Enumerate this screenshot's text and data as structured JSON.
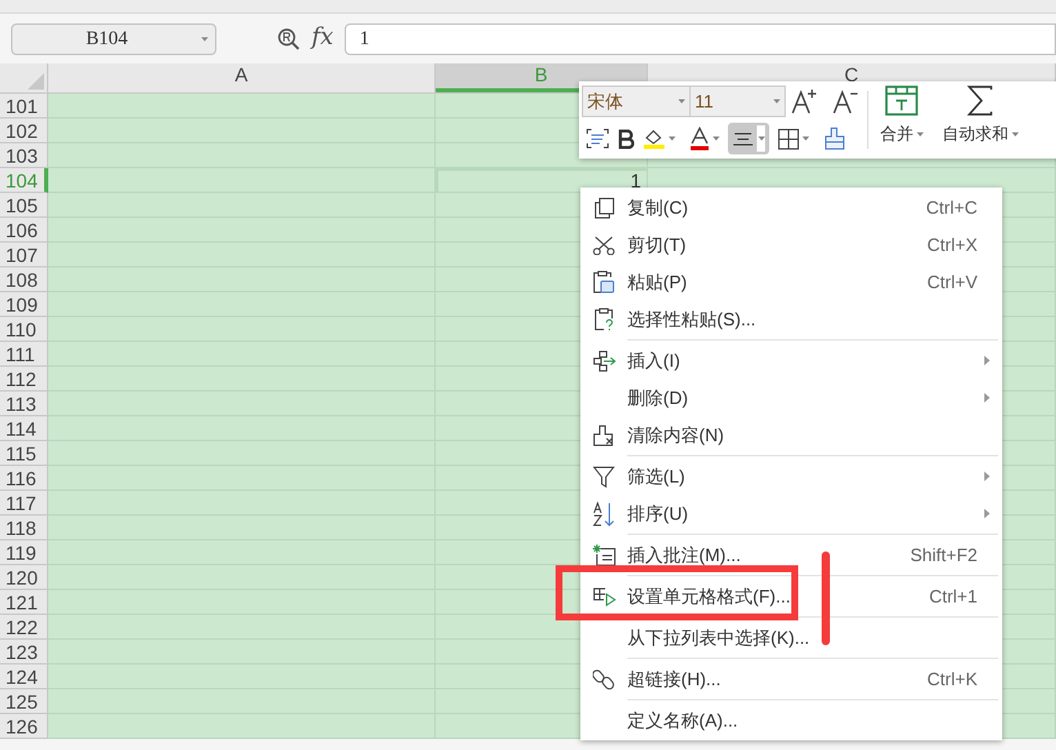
{
  "formula_bar": {
    "name_box": "B104",
    "function_label": "fx",
    "formula": "1"
  },
  "columns": [
    {
      "label": "A",
      "selected": false
    },
    {
      "label": "B",
      "selected": true
    },
    {
      "label": "C",
      "selected": false
    }
  ],
  "rows": [
    {
      "label": "101",
      "selected": false
    },
    {
      "label": "102",
      "selected": false
    },
    {
      "label": "103",
      "selected": false
    },
    {
      "label": "104",
      "selected": true,
      "cell_b": "1"
    },
    {
      "label": "105",
      "selected": false
    },
    {
      "label": "106",
      "selected": false
    },
    {
      "label": "107",
      "selected": false
    },
    {
      "label": "108",
      "selected": false
    },
    {
      "label": "109",
      "selected": false
    },
    {
      "label": "110",
      "selected": false
    },
    {
      "label": "111",
      "selected": false
    },
    {
      "label": "112",
      "selected": false
    },
    {
      "label": "113",
      "selected": false
    },
    {
      "label": "114",
      "selected": false
    },
    {
      "label": "115",
      "selected": false
    },
    {
      "label": "116",
      "selected": false
    },
    {
      "label": "117",
      "selected": false
    },
    {
      "label": "118",
      "selected": false
    },
    {
      "label": "119",
      "selected": false
    },
    {
      "label": "120",
      "selected": false
    },
    {
      "label": "121",
      "selected": false
    },
    {
      "label": "122",
      "selected": false
    },
    {
      "label": "123",
      "selected": false
    },
    {
      "label": "124",
      "selected": false
    },
    {
      "label": "125",
      "selected": false
    },
    {
      "label": "126",
      "selected": false
    }
  ],
  "mini_toolbar": {
    "font": "宋体",
    "size": "11",
    "merge": "合并",
    "autosum": "自动求和"
  },
  "context_menu": [
    {
      "kind": "item",
      "label": "复制(C)",
      "shortcut": "Ctrl+C",
      "submenu": false
    },
    {
      "kind": "item",
      "label": "剪切(T)",
      "shortcut": "Ctrl+X",
      "submenu": false
    },
    {
      "kind": "item",
      "label": "粘贴(P)",
      "shortcut": "Ctrl+V",
      "submenu": false
    },
    {
      "kind": "item",
      "label": "选择性粘贴(S)...",
      "submenu": false
    },
    {
      "kind": "separator"
    },
    {
      "kind": "item",
      "label": "插入(I)",
      "submenu": true
    },
    {
      "kind": "item",
      "label": "删除(D)",
      "submenu": true
    },
    {
      "kind": "item",
      "label": "清除内容(N)",
      "submenu": false
    },
    {
      "kind": "separator"
    },
    {
      "kind": "item",
      "label": "筛选(L)",
      "submenu": true
    },
    {
      "kind": "item",
      "label": "排序(U)",
      "submenu": true
    },
    {
      "kind": "separator"
    },
    {
      "kind": "item",
      "label": "插入批注(M)...",
      "shortcut": "Shift+F2",
      "submenu": false
    },
    {
      "kind": "separator"
    },
    {
      "kind": "item",
      "label": "设置单元格格式(F)...",
      "shortcut": "Ctrl+1",
      "submenu": false
    },
    {
      "kind": "separator"
    },
    {
      "kind": "item",
      "label": "从下拉列表中选择(K)...",
      "submenu": false
    },
    {
      "kind": "separator"
    },
    {
      "kind": "item",
      "label": "超链接(H)...",
      "shortcut": "Ctrl+K",
      "submenu": false
    },
    {
      "kind": "separator"
    },
    {
      "kind": "item",
      "label": "定义名称(A)...",
      "submenu": false
    }
  ]
}
